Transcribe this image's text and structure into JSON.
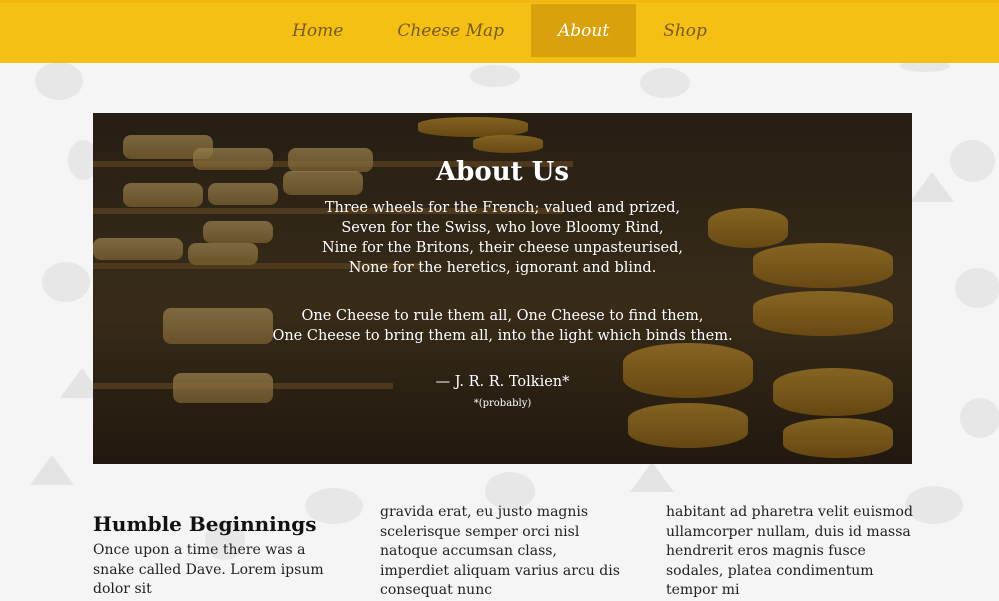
{
  "nav": {
    "items": [
      {
        "label": "Home",
        "active": false
      },
      {
        "label": "Cheese Map",
        "active": false
      },
      {
        "label": "About",
        "active": true
      },
      {
        "label": "Shop",
        "active": false
      }
    ],
    "bar_color": "#f5c014",
    "active_color": "#d9a20d"
  },
  "hero": {
    "title": "About Us",
    "poem_lines": [
      "Three wheels for the French; valued and prized,",
      "Seven for the Swiss, who love Bloomy Rind,",
      "Nine for the Britons, their cheese unpasteurised,",
      "None for the heretics, ignorant and blind."
    ],
    "poem2_lines": [
      "One Cheese to rule them all, One Cheese to find them,",
      "One Cheese to bring them all, into the light which binds them."
    ],
    "attribution": "— J. R. R. Tolkien*",
    "note": "*(probably)"
  },
  "columns": {
    "heading": "Humble Beginnings",
    "col1_text": "Once upon a time there was a snake called Dave. Lorem ipsum dolor sit",
    "col2_text": "gravida erat, eu justo magnis scelerisque semper orci nisl natoque accumsan class, imperdiet aliquam varius arcu dis consequat nunc",
    "col3_text": "habitant ad pharetra velit euismod ullamcorper nullam, duis id massa hendrerit eros magnis fusce sodales, platea condimentum tempor mi"
  }
}
